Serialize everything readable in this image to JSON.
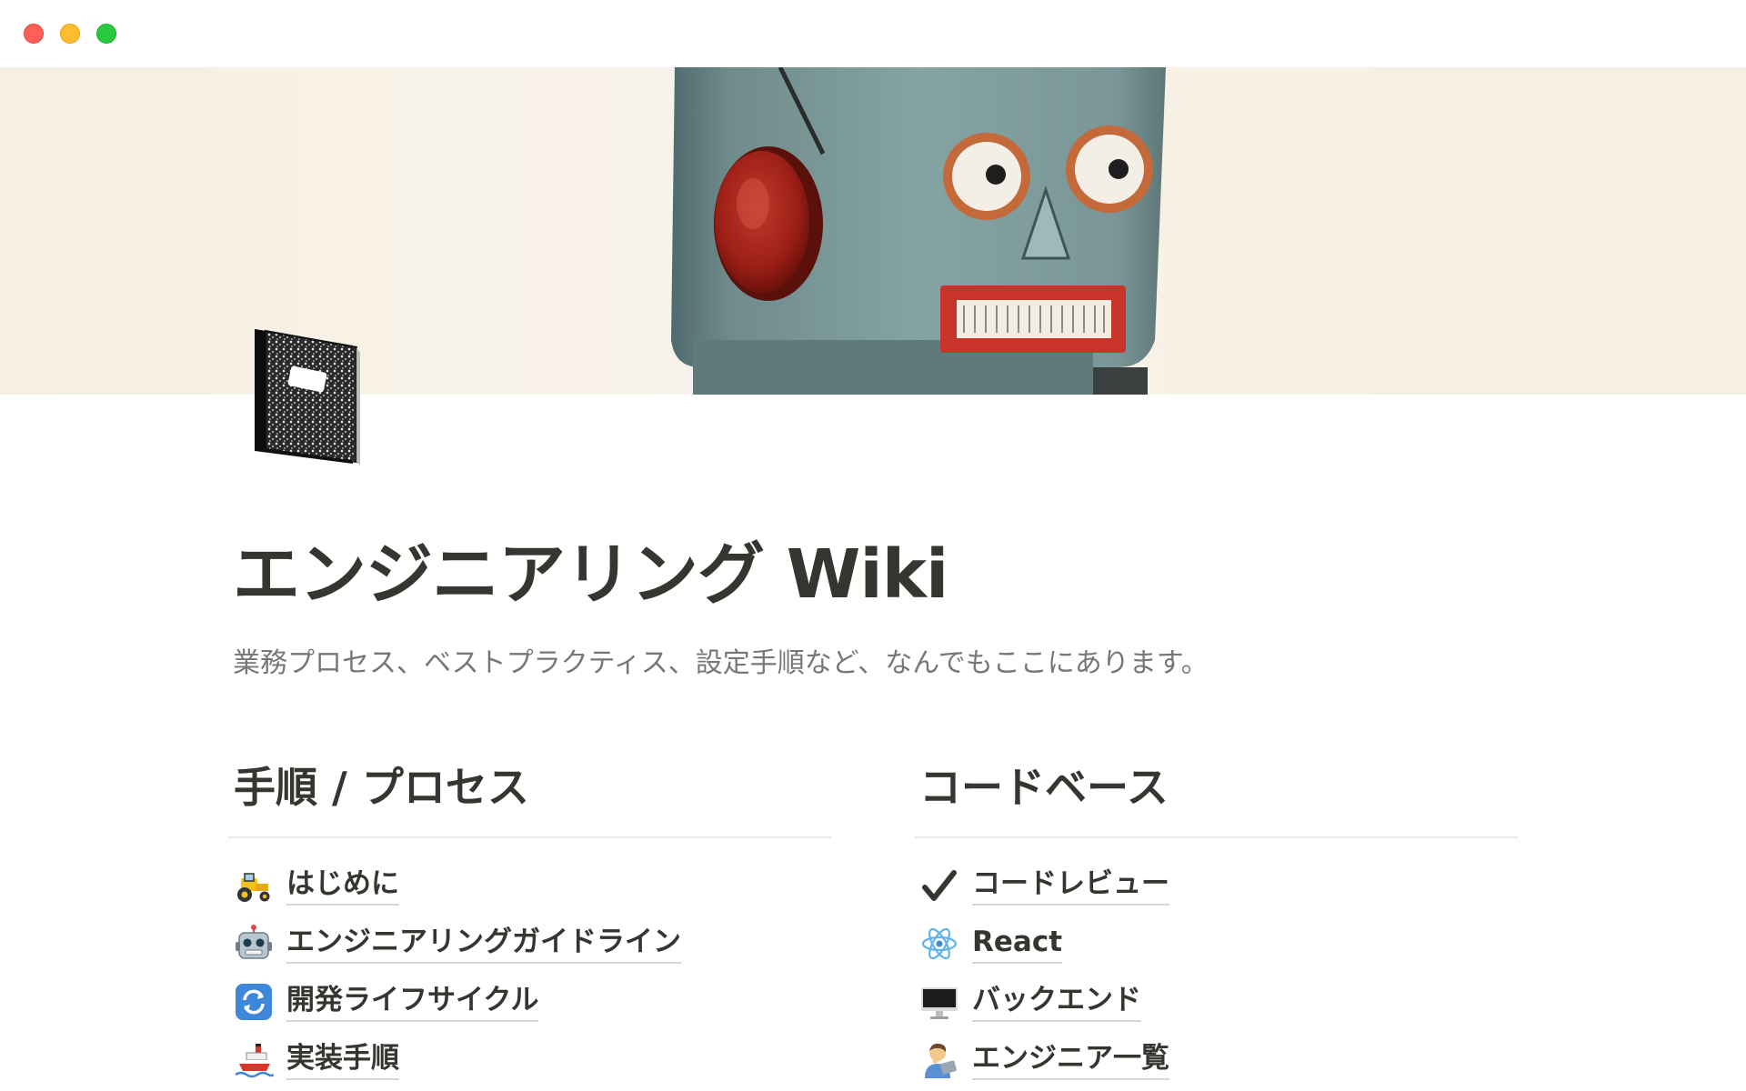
{
  "window": {
    "controls": [
      "close",
      "minimize",
      "zoom"
    ]
  },
  "cover": {
    "image": "robot-face-photo"
  },
  "page": {
    "icon": "composition-notebook-icon",
    "title": "エンジニアリング Wiki",
    "description": "業務プロセス、ベストプラクティス、設定手順など、なんでもここにあります。"
  },
  "sections": [
    {
      "heading": "手順 / プロセス",
      "links": [
        {
          "icon": "tractor-icon",
          "label": "はじめに"
        },
        {
          "icon": "robot-icon",
          "label": "エンジニアリングガイドライン"
        },
        {
          "icon": "refresh-arrows-icon",
          "label": "開発ライフサイクル"
        },
        {
          "icon": "ship-icon",
          "label": "実装手順"
        }
      ]
    },
    {
      "heading": "コードベース",
      "links": [
        {
          "icon": "check-mark-icon",
          "label": "コードレビュー"
        },
        {
          "icon": "atom-icon",
          "label": "React"
        },
        {
          "icon": "desktop-computer-icon",
          "label": "バックエンド"
        },
        {
          "icon": "technologist-icon",
          "label": "エンジニア一覧"
        }
      ]
    }
  ],
  "colors": {
    "text": "#37352f",
    "muted": "#787774",
    "divider": "#e9e9e7",
    "close": "#ff5f57",
    "minimize": "#febc2e",
    "zoom": "#28c840"
  }
}
